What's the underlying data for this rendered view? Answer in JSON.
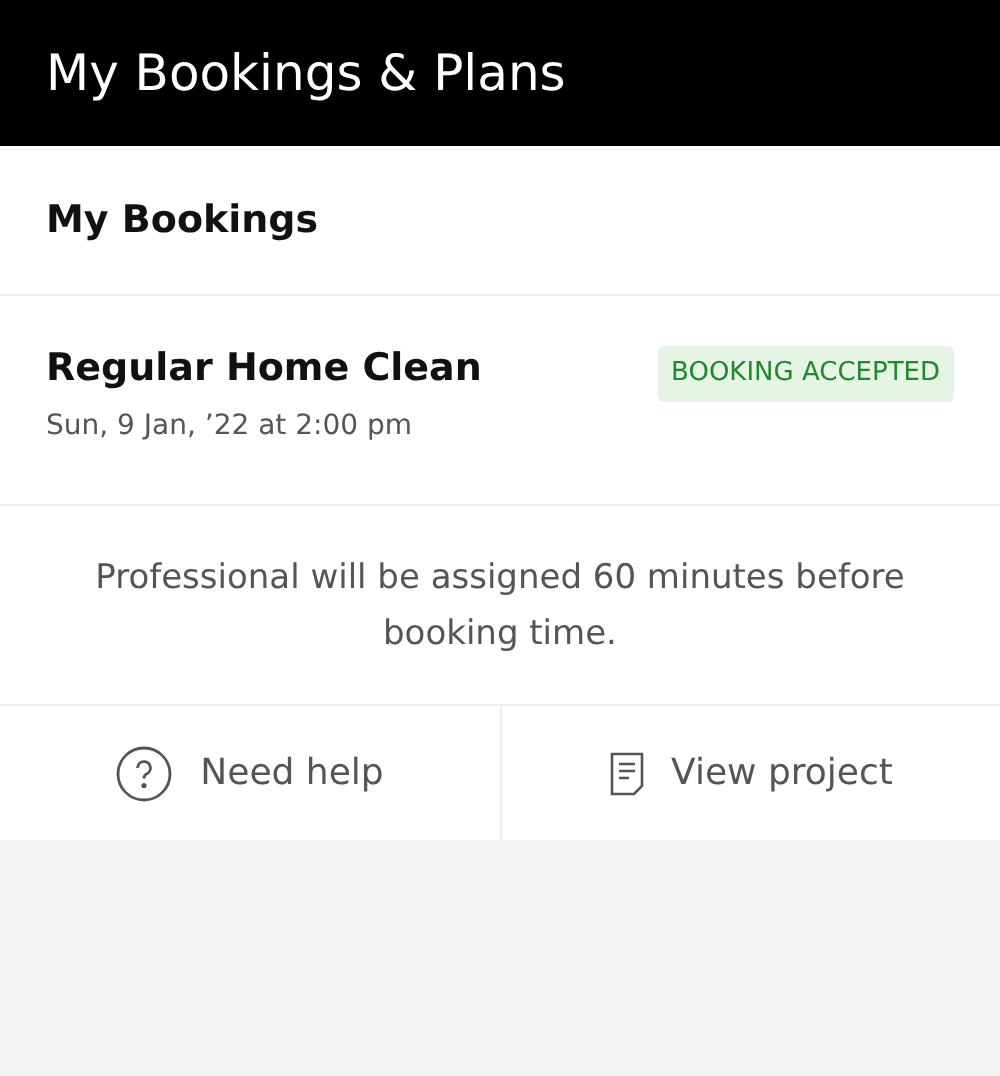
{
  "header": {
    "title": "My Bookings & Plans"
  },
  "section": {
    "title": "My Bookings"
  },
  "booking": {
    "title": "Regular Home Clean",
    "date": "Sun, 9 Jan, ’22 at 2:00 pm",
    "status": {
      "text": "BOOKING ACCEPTED",
      "kind": "accepted"
    },
    "note": "Professional will be assigned 60 minutes before booking time."
  },
  "actions": [
    {
      "label": "Need help",
      "kind": "help"
    },
    {
      "label": "View project",
      "kind": "document"
    }
  ]
}
